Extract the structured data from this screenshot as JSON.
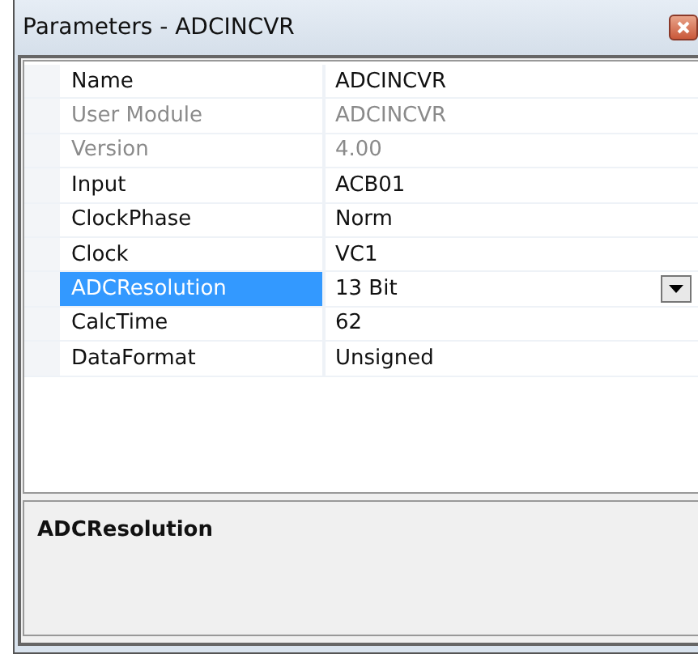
{
  "window": {
    "title": "Parameters - ADCINCVR"
  },
  "properties": [
    {
      "name": "Name",
      "value": "ADCINCVR",
      "disabled": false,
      "selected": false
    },
    {
      "name": "User Module",
      "value": "ADCINCVR",
      "disabled": true,
      "selected": false
    },
    {
      "name": "Version",
      "value": "4.00",
      "disabled": true,
      "selected": false
    },
    {
      "name": "Input",
      "value": "ACB01",
      "disabled": false,
      "selected": false
    },
    {
      "name": "ClockPhase",
      "value": "Norm",
      "disabled": false,
      "selected": false
    },
    {
      "name": "Clock",
      "value": "VC1",
      "disabled": false,
      "selected": false
    },
    {
      "name": "ADCResolution",
      "value": "13 Bit",
      "disabled": false,
      "selected": true
    },
    {
      "name": "CalcTime",
      "value": "62",
      "disabled": false,
      "selected": false
    },
    {
      "name": "DataFormat",
      "value": "Unsigned",
      "disabled": false,
      "selected": false
    }
  ],
  "description": {
    "title": "ADCResolution"
  }
}
